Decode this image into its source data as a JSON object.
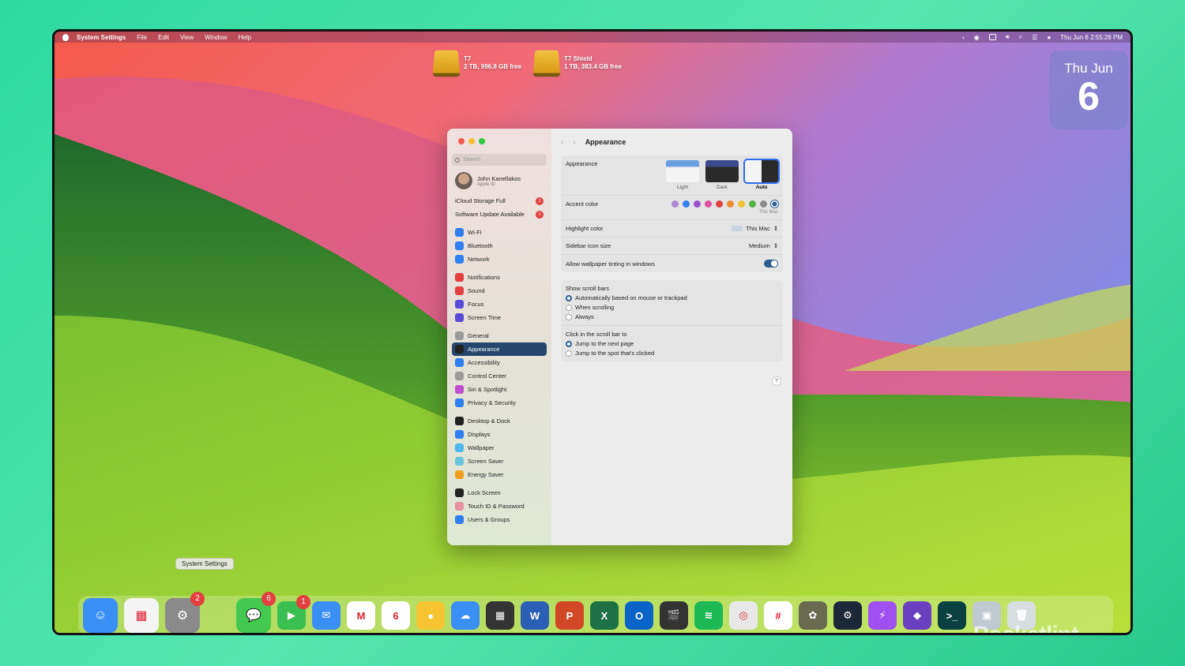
{
  "menubar": {
    "app": "System Settings",
    "items": [
      "File",
      "Edit",
      "View",
      "Window",
      "Help"
    ],
    "clock": "Thu Jun 6  2:55:26 PM"
  },
  "drives": [
    {
      "name": "T7",
      "info": "2 TB, 996.8 GB free"
    },
    {
      "name": "T7 Shield",
      "info": "1 TB, 383.4 GB free"
    }
  ],
  "date_widget": {
    "day": "Thu Jun",
    "num": "6"
  },
  "sidebar": {
    "search_placeholder": "Search",
    "user": {
      "name": "John Kanellakos",
      "sub": "Apple ID"
    },
    "alerts": [
      {
        "label": "iCloud Storage Full",
        "count": "1"
      },
      {
        "label": "Software Update Available",
        "count": "1"
      }
    ],
    "groups": [
      [
        {
          "label": "Wi-Fi",
          "color": "#2f7ff0",
          "icon": "wifi-icon"
        },
        {
          "label": "Bluetooth",
          "color": "#2f7ff0",
          "icon": "bluetooth-icon"
        },
        {
          "label": "Network",
          "color": "#2f7ff0",
          "icon": "globe-icon"
        }
      ],
      [
        {
          "label": "Notifications",
          "color": "#e34040",
          "icon": "bell-icon"
        },
        {
          "label": "Sound",
          "color": "#e34040",
          "icon": "speaker-icon"
        },
        {
          "label": "Focus",
          "color": "#5a4bd6",
          "icon": "moon-icon"
        },
        {
          "label": "Screen Time",
          "color": "#5a4bd6",
          "icon": "hourglass-icon"
        }
      ],
      [
        {
          "label": "General",
          "color": "#9a9a9a",
          "icon": "gear-icon"
        },
        {
          "label": "Appearance",
          "color": "#222",
          "icon": "appearance-icon",
          "selected": true
        },
        {
          "label": "Accessibility",
          "color": "#2f7ff0",
          "icon": "accessibility-icon"
        },
        {
          "label": "Control Center",
          "color": "#9a9a9a",
          "icon": "control-center-icon"
        },
        {
          "label": "Siri & Spotlight",
          "color": "#c04fd0",
          "icon": "siri-icon"
        },
        {
          "label": "Privacy & Security",
          "color": "#2f7ff0",
          "icon": "hand-icon"
        }
      ],
      [
        {
          "label": "Desktop & Dock",
          "color": "#222",
          "icon": "dock-icon"
        },
        {
          "label": "Displays",
          "color": "#2f7ff0",
          "icon": "sun-icon"
        },
        {
          "label": "Wallpaper",
          "color": "#4fb8f0",
          "icon": "wallpaper-icon"
        },
        {
          "label": "Screen Saver",
          "color": "#6ac4e0",
          "icon": "screensaver-icon"
        },
        {
          "label": "Energy Saver",
          "color": "#f0a020",
          "icon": "battery-icon"
        }
      ],
      [
        {
          "label": "Lock Screen",
          "color": "#222",
          "icon": "lock-icon"
        },
        {
          "label": "Touch ID & Password",
          "color": "#e890a0",
          "icon": "fingerprint-icon"
        },
        {
          "label": "Users & Groups",
          "color": "#2f7ff0",
          "icon": "users-icon"
        }
      ]
    ]
  },
  "main": {
    "title": "Appearance",
    "appearance": {
      "label": "Appearance",
      "options": [
        {
          "label": "Light",
          "selected": false
        },
        {
          "label": "Dark",
          "selected": false
        },
        {
          "label": "Auto",
          "selected": true
        }
      ]
    },
    "accent": {
      "label": "Accent color",
      "colors": [
        "#b088d0",
        "#2f7ff0",
        "#9a4fd0",
        "#e04fa0",
        "#e34040",
        "#f08a30",
        "#f0c030",
        "#50b040",
        "#8a8a8a",
        "#2b5e8f"
      ],
      "caption": "This Mac"
    },
    "highlight": {
      "label": "Highlight color",
      "value": "This Mac"
    },
    "icon_size": {
      "label": "Sidebar icon size",
      "value": "Medium"
    },
    "tinting": {
      "label": "Allow wallpaper tinting in windows",
      "on": true
    },
    "scroll_bars": {
      "label": "Show scroll bars",
      "options": [
        {
          "label": "Automatically based on mouse or trackpad",
          "on": true
        },
        {
          "label": "When scrolling",
          "on": false
        },
        {
          "label": "Always",
          "on": false
        }
      ]
    },
    "click_scroll": {
      "label": "Click in the scroll bar to",
      "options": [
        {
          "label": "Jump to the next page",
          "on": true
        },
        {
          "label": "Jump to the spot that's clicked",
          "on": false
        }
      ]
    },
    "help": "?"
  },
  "tooltip": "System Settings",
  "dock": {
    "apps": [
      {
        "name": "finder-icon",
        "color": "#3a8ff5",
        "glyph": "☺"
      },
      {
        "name": "launchpad-icon",
        "color": "#f4f4f4",
        "glyph": "▦"
      },
      {
        "name": "system-settings-icon",
        "color": "#8a8a8a",
        "glyph": "⚙",
        "badge": "2"
      },
      {
        "gap": true
      },
      {
        "name": "messages-icon",
        "color": "#43c850",
        "glyph": "💬",
        "badge": "6"
      },
      {
        "name": "facetime-icon",
        "color": "#3ac050",
        "glyph": "▶",
        "badge": "1",
        "small": true
      },
      {
        "name": "mail-icon",
        "color": "#3a8ff5",
        "glyph": "✉",
        "small": true
      },
      {
        "name": "gmail-icon",
        "color": "#ffffff",
        "glyph": "M",
        "small": true
      },
      {
        "name": "calendar-icon",
        "color": "#ffffff",
        "glyph": "6",
        "small": true
      },
      {
        "name": "notes-icon",
        "color": "#f6c430",
        "glyph": "●",
        "small": true
      },
      {
        "name": "weather-icon",
        "color": "#3a8ff5",
        "glyph": "☁",
        "small": true
      },
      {
        "name": "calculator-icon",
        "color": "#333333",
        "glyph": "▦",
        "small": true
      },
      {
        "name": "word-icon",
        "color": "#2b5fb5",
        "glyph": "W",
        "small": true
      },
      {
        "name": "powerpoint-icon",
        "color": "#d24726",
        "glyph": "P",
        "small": true
      },
      {
        "name": "excel-icon",
        "color": "#1e7145",
        "glyph": "X",
        "small": true
      },
      {
        "name": "outlook-icon",
        "color": "#0a64c8",
        "glyph": "O",
        "small": true
      },
      {
        "name": "final-cut-icon",
        "color": "#333333",
        "glyph": "🎬",
        "small": true
      },
      {
        "name": "spotify-icon",
        "color": "#1db954",
        "glyph": "≋",
        "small": true
      },
      {
        "name": "chrome-icon",
        "color": "#e8e8e8",
        "glyph": "◎",
        "small": true
      },
      {
        "name": "slack-icon",
        "color": "#ffffff",
        "glyph": "#",
        "small": true
      },
      {
        "name": "gimp-icon",
        "color": "#6a6a50",
        "glyph": "✿",
        "small": true
      },
      {
        "name": "steam-icon",
        "color": "#1b2838",
        "glyph": "⚙",
        "small": true
      },
      {
        "name": "messenger-icon",
        "color": "#a050f0",
        "glyph": "⚡",
        "small": true
      },
      {
        "name": "affinity-icon",
        "color": "#6a40c0",
        "glyph": "◆",
        "small": true
      },
      {
        "name": "terminal-icon",
        "color": "#0a4040",
        "glyph": ">_",
        "small": true
      },
      {
        "name": "preview-icon",
        "color": "#c0c8d0",
        "glyph": "▣",
        "small": true
      },
      {
        "name": "trash-icon",
        "color": "#d8dde0",
        "glyph": "🗑",
        "small": true
      }
    ]
  },
  "watermark": "Pocketlint"
}
